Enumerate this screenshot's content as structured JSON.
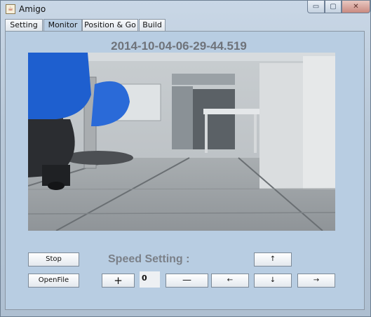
{
  "window": {
    "title": "Amigo",
    "app_icon": "java-cup-icon"
  },
  "title_buttons": {
    "minimize": "▭",
    "maximize": "▢",
    "close": "✕"
  },
  "tabs": [
    {
      "label": "Setting",
      "active": false
    },
    {
      "label": "Monitor",
      "active": true
    },
    {
      "label": "Position & Go",
      "active": false
    },
    {
      "label": "Build",
      "active": false
    }
  ],
  "monitor": {
    "timestamp": "2014-10-04-06-29-44.519",
    "camera_feed": "robot-camera-view",
    "speed_label": "Speed Setting :",
    "speed_value": "0",
    "buttons": {
      "stop": "Stop",
      "open_file": "OpenFile",
      "plus": "+",
      "minus": "—",
      "up": "↑",
      "down": "↓",
      "left": "←",
      "right": "→"
    }
  }
}
